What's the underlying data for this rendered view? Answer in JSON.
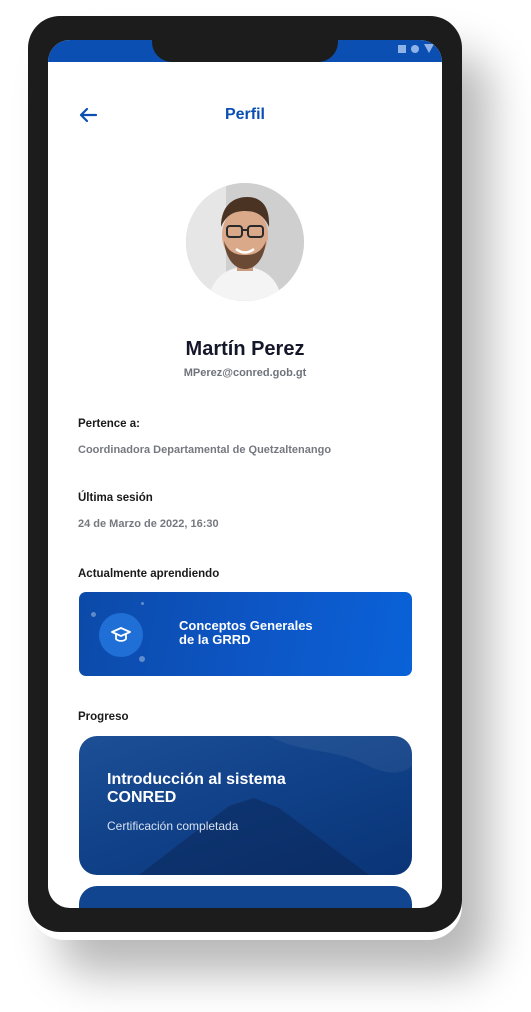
{
  "header": {
    "title": "Perfil",
    "back_icon": "arrow-left-icon"
  },
  "profile": {
    "name": "Martín Perez",
    "email": "MPerez@conred.gob.gt"
  },
  "fields": {
    "belongs_label": "Pertence a:",
    "belongs_value": "Coordinadora Departamental de Quetzaltenango",
    "last_session_label": "Última sesión",
    "last_session_value": "24 de Marzo de 2022, 16:30"
  },
  "learning": {
    "section_label": "Actualmente aprendiendo",
    "course_line1": "Conceptos Generales",
    "course_line2": "de la GRRD",
    "icon": "graduation-cap-icon"
  },
  "progress": {
    "section_label": "Progreso",
    "card_title_line1": "Introducción al sistema",
    "card_title_line2": "CONRED",
    "card_status": "Certificación completada"
  },
  "colors": {
    "accent": "#0b4fb3",
    "card_dark": "#0f3f86"
  }
}
